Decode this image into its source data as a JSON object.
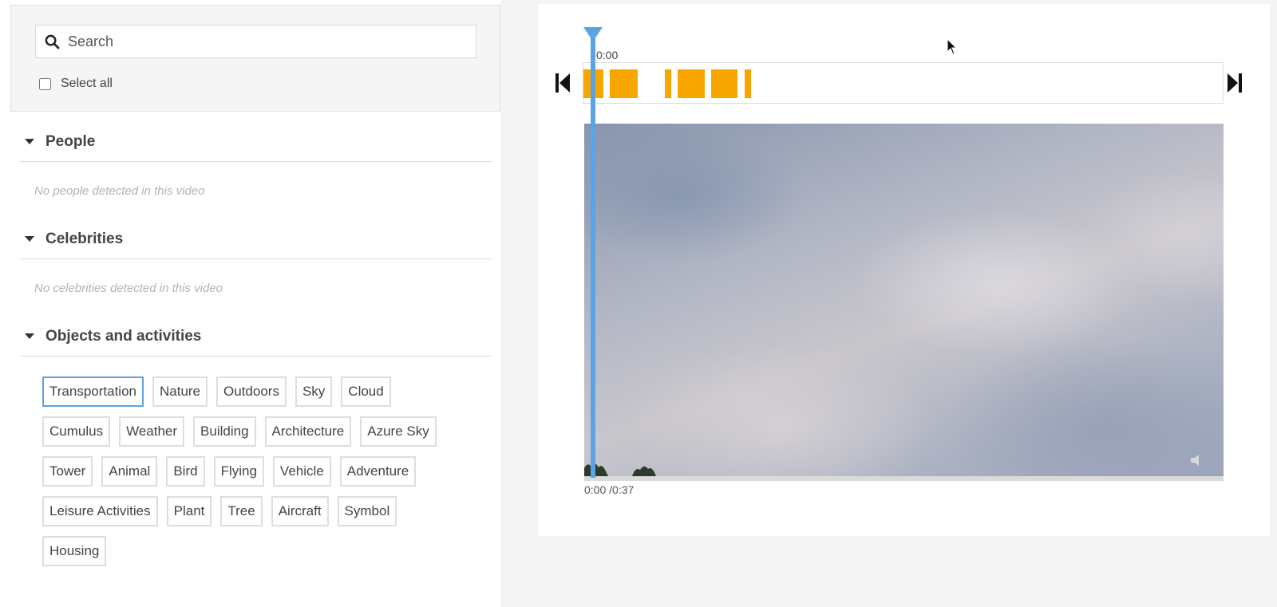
{
  "search": {
    "placeholder": "Search"
  },
  "select_all": {
    "label": "Select all",
    "checked": false
  },
  "sections": {
    "people": {
      "title": "People",
      "empty": "No people detected in this video"
    },
    "celebrities": {
      "title": "Celebrities",
      "empty": "No celebrities detected in this video"
    },
    "objects": {
      "title": "Objects and activities"
    }
  },
  "tags": [
    [
      "Transportation",
      "Nature",
      "Outdoors",
      "Sky",
      "Cloud"
    ],
    [
      "Cumulus",
      "Weather",
      "Building",
      "Architecture",
      "Azure Sky"
    ],
    [
      "Tower",
      "Animal",
      "Bird",
      "Flying",
      "Vehicle",
      "Adventure"
    ],
    [
      "Leisure Activities",
      "Plant",
      "Tree",
      "Aircraft",
      "Symbol"
    ],
    [
      "Housing"
    ]
  ],
  "selected_tag": "Transportation",
  "timeline": {
    "current_time_label": "0:00",
    "segment_color": "#f7a600",
    "playhead_color": "#5aa4e6"
  },
  "video": {
    "time_display": "0:00 /0:37",
    "progress": 0
  },
  "icons": {
    "search": "search-icon",
    "skip_back": "skip-back-icon",
    "skip_forward": "skip-forward-icon",
    "mute": "mute-icon"
  }
}
